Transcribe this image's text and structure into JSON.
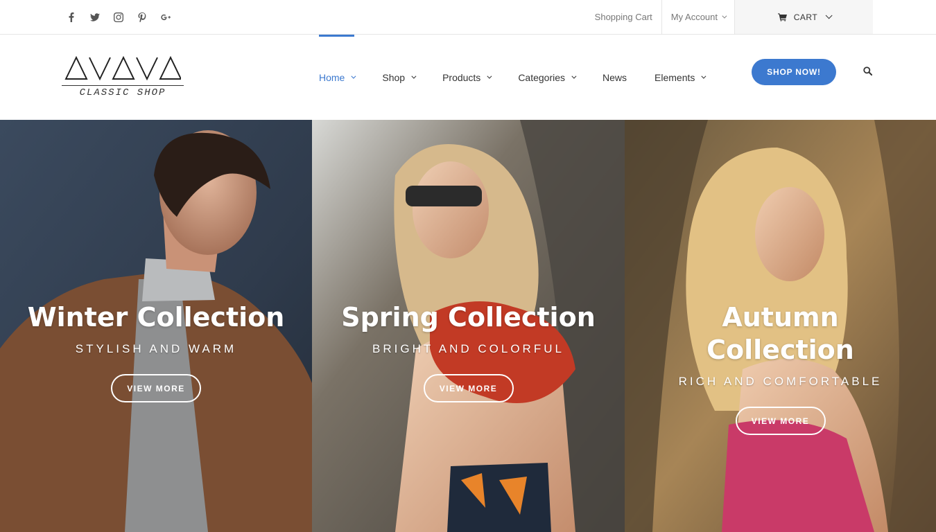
{
  "topbar": {
    "social_icons": [
      "facebook-icon",
      "twitter-icon",
      "instagram-icon",
      "pinterest-icon",
      "google-plus-icon"
    ],
    "shopping_cart_link": "Shopping Cart",
    "my_account_link": "My Account",
    "cart_label": "CART"
  },
  "logo": {
    "wordmark": "AVAVA",
    "subtitle": "CLASSIC SHOP"
  },
  "nav": {
    "items": [
      {
        "label": "Home",
        "active": true,
        "has_dropdown": true
      },
      {
        "label": "Shop",
        "active": false,
        "has_dropdown": true
      },
      {
        "label": "Products",
        "active": false,
        "has_dropdown": true
      },
      {
        "label": "Categories",
        "active": false,
        "has_dropdown": true
      },
      {
        "label": "News",
        "active": false,
        "has_dropdown": false
      },
      {
        "label": "Elements",
        "active": false,
        "has_dropdown": true
      }
    ],
    "cta_label": "SHOP NOW!",
    "search_icon": "search-icon"
  },
  "hero": {
    "panels": [
      {
        "title": "Winter Collection",
        "subtitle": "STYLISH AND WARM",
        "button": "VIEW MORE"
      },
      {
        "title": "Spring Collection",
        "subtitle": "BRIGHT AND COLORFUL",
        "button": "VIEW MORE"
      },
      {
        "title": "Autumn Collection",
        "subtitle": "RICH AND COMFORTABLE",
        "button": "VIEW MORE"
      }
    ]
  },
  "colors": {
    "accent": "#3c79cf",
    "text": "#333333",
    "muted": "#777777"
  }
}
